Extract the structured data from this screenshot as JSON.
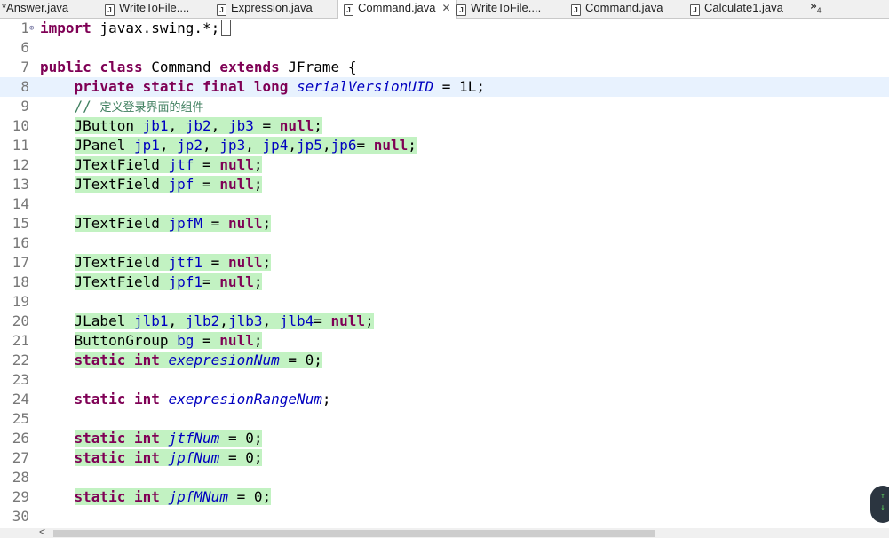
{
  "tabs": [
    {
      "label": "*Answer.java",
      "active": false
    },
    {
      "label": "WriteToFile....",
      "active": false
    },
    {
      "label": "Expression.java",
      "active": false
    },
    {
      "label": "Command.java",
      "active": true
    },
    {
      "label": "WriteToFile....",
      "active": false
    },
    {
      "label": "Command.java",
      "active": false
    },
    {
      "label": "Calculate1.java",
      "active": false
    }
  ],
  "tab_close_glyph": "✕",
  "overflow": {
    "chevron": "»",
    "count": "4"
  },
  "editor": {
    "current_line": 8,
    "highlight_color": "#c2f2c2",
    "lines": [
      {
        "n": "1",
        "tokens": [
          {
            "t": "import",
            "c": "kw"
          },
          {
            "t": " javax.swing.*;",
            "c": ""
          }
        ]
      },
      {
        "n": "6",
        "tokens": []
      },
      {
        "n": "7",
        "tokens": [
          {
            "t": "public",
            "c": "kw"
          },
          {
            "t": " ",
            "c": ""
          },
          {
            "t": "class",
            "c": "kw"
          },
          {
            "t": " Command ",
            "c": ""
          },
          {
            "t": "extends",
            "c": "kw"
          },
          {
            "t": " JFrame {",
            "c": ""
          }
        ]
      },
      {
        "n": "8",
        "tokens": [
          {
            "t": "    ",
            "c": ""
          },
          {
            "t": "private",
            "c": "kw"
          },
          {
            "t": " ",
            "c": ""
          },
          {
            "t": "static",
            "c": "kw"
          },
          {
            "t": " ",
            "c": ""
          },
          {
            "t": "final",
            "c": "kw"
          },
          {
            "t": " ",
            "c": ""
          },
          {
            "t": "long",
            "c": "kw"
          },
          {
            "t": " ",
            "c": ""
          },
          {
            "t": "serialVersionUID",
            "c": "sf"
          },
          {
            "t": " = 1L;",
            "c": ""
          }
        ]
      },
      {
        "n": "9",
        "tokens": [
          {
            "t": "    ",
            "c": ""
          },
          {
            "t": "// ",
            "c": "cm"
          },
          {
            "t": "定义登录界面的组件",
            "c": "cm cmtxt"
          }
        ]
      },
      {
        "n": "10",
        "tokens": [
          {
            "t": "    ",
            "c": ""
          },
          {
            "t": "JButton ",
            "c": "hl"
          },
          {
            "t": "jb1",
            "c": "hl fld"
          },
          {
            "t": ", ",
            "c": "hl"
          },
          {
            "t": "jb2",
            "c": "hl fld"
          },
          {
            "t": ", ",
            "c": "hl"
          },
          {
            "t": "jb3",
            "c": "hl fld"
          },
          {
            "t": " = ",
            "c": "hl"
          },
          {
            "t": "null",
            "c": "hl kw"
          },
          {
            "t": ";",
            "c": "hl"
          }
        ]
      },
      {
        "n": "11",
        "tokens": [
          {
            "t": "    ",
            "c": ""
          },
          {
            "t": "JPanel ",
            "c": "hl"
          },
          {
            "t": "jp1",
            "c": "hl fld"
          },
          {
            "t": ", ",
            "c": "hl"
          },
          {
            "t": "jp2",
            "c": "hl fld"
          },
          {
            "t": ", ",
            "c": "hl"
          },
          {
            "t": "jp3",
            "c": "hl fld"
          },
          {
            "t": ", ",
            "c": "hl"
          },
          {
            "t": "jp4",
            "c": "hl fld"
          },
          {
            "t": ",",
            "c": "hl"
          },
          {
            "t": "jp5",
            "c": "hl fld"
          },
          {
            "t": ",",
            "c": "hl"
          },
          {
            "t": "jp6",
            "c": "hl fld"
          },
          {
            "t": "= ",
            "c": "hl"
          },
          {
            "t": "null",
            "c": "hl kw"
          },
          {
            "t": ";",
            "c": "hl"
          }
        ]
      },
      {
        "n": "12",
        "tokens": [
          {
            "t": "    ",
            "c": ""
          },
          {
            "t": "JTextField ",
            "c": "hl"
          },
          {
            "t": "jtf",
            "c": "hl fld"
          },
          {
            "t": " = ",
            "c": "hl"
          },
          {
            "t": "null",
            "c": "hl kw"
          },
          {
            "t": ";",
            "c": "hl"
          }
        ]
      },
      {
        "n": "13",
        "tokens": [
          {
            "t": "    ",
            "c": ""
          },
          {
            "t": "JTextField ",
            "c": "hl"
          },
          {
            "t": "jpf",
            "c": "hl fld"
          },
          {
            "t": " = ",
            "c": "hl"
          },
          {
            "t": "null",
            "c": "hl kw"
          },
          {
            "t": ";",
            "c": "hl"
          }
        ]
      },
      {
        "n": "14",
        "tokens": []
      },
      {
        "n": "15",
        "tokens": [
          {
            "t": "    ",
            "c": ""
          },
          {
            "t": "JTextField ",
            "c": "hl"
          },
          {
            "t": "jpfM",
            "c": "hl fld"
          },
          {
            "t": " = ",
            "c": "hl"
          },
          {
            "t": "null",
            "c": "hl kw"
          },
          {
            "t": ";",
            "c": "hl"
          }
        ]
      },
      {
        "n": "16",
        "tokens": []
      },
      {
        "n": "17",
        "tokens": [
          {
            "t": "    ",
            "c": ""
          },
          {
            "t": "JTextField ",
            "c": "hl"
          },
          {
            "t": "jtf1",
            "c": "hl fld"
          },
          {
            "t": " = ",
            "c": "hl"
          },
          {
            "t": "null",
            "c": "hl kw"
          },
          {
            "t": ";",
            "c": "hl"
          }
        ]
      },
      {
        "n": "18",
        "tokens": [
          {
            "t": "    ",
            "c": ""
          },
          {
            "t": "JTextField ",
            "c": "hl"
          },
          {
            "t": "jpf1",
            "c": "hl fld"
          },
          {
            "t": "= ",
            "c": "hl"
          },
          {
            "t": "null",
            "c": "hl kw"
          },
          {
            "t": ";",
            "c": "hl"
          }
        ]
      },
      {
        "n": "19",
        "tokens": []
      },
      {
        "n": "20",
        "tokens": [
          {
            "t": "    ",
            "c": ""
          },
          {
            "t": "JLabel ",
            "c": "hl"
          },
          {
            "t": "jlb1",
            "c": "hl fld"
          },
          {
            "t": ", ",
            "c": "hl"
          },
          {
            "t": "jlb2",
            "c": "hl fld"
          },
          {
            "t": ",",
            "c": "hl"
          },
          {
            "t": "jlb3",
            "c": "hl fld"
          },
          {
            "t": ", ",
            "c": "hl"
          },
          {
            "t": "jlb4",
            "c": "hl fld"
          },
          {
            "t": "= ",
            "c": "hl"
          },
          {
            "t": "null",
            "c": "hl kw"
          },
          {
            "t": ";",
            "c": "hl"
          }
        ]
      },
      {
        "n": "21",
        "tokens": [
          {
            "t": "    ",
            "c": ""
          },
          {
            "t": "ButtonGroup ",
            "c": "hl"
          },
          {
            "t": "bg",
            "c": "hl fld"
          },
          {
            "t": " = ",
            "c": "hl"
          },
          {
            "t": "null",
            "c": "hl kw"
          },
          {
            "t": ";",
            "c": "hl"
          }
        ]
      },
      {
        "n": "22",
        "tokens": [
          {
            "t": "    ",
            "c": ""
          },
          {
            "t": "static",
            "c": "hl kw"
          },
          {
            "t": " ",
            "c": "hl"
          },
          {
            "t": "int",
            "c": "hl kw"
          },
          {
            "t": " ",
            "c": "hl"
          },
          {
            "t": "exepresionNum",
            "c": "hl sf"
          },
          {
            "t": " = 0;",
            "c": "hl"
          }
        ]
      },
      {
        "n": "23",
        "tokens": []
      },
      {
        "n": "24",
        "tokens": [
          {
            "t": "    ",
            "c": ""
          },
          {
            "t": "static",
            "c": "kw"
          },
          {
            "t": " ",
            "c": ""
          },
          {
            "t": "int",
            "c": "kw"
          },
          {
            "t": " ",
            "c": ""
          },
          {
            "t": "exepresionRangeNum",
            "c": "sf"
          },
          {
            "t": ";",
            "c": ""
          }
        ]
      },
      {
        "n": "25",
        "tokens": []
      },
      {
        "n": "26",
        "tokens": [
          {
            "t": "    ",
            "c": ""
          },
          {
            "t": "static",
            "c": "hl kw"
          },
          {
            "t": " ",
            "c": "hl"
          },
          {
            "t": "int",
            "c": "hl kw"
          },
          {
            "t": " ",
            "c": "hl"
          },
          {
            "t": "jtfNum",
            "c": "hl sf"
          },
          {
            "t": " = 0;",
            "c": "hl"
          }
        ]
      },
      {
        "n": "27",
        "tokens": [
          {
            "t": "    ",
            "c": ""
          },
          {
            "t": "static",
            "c": "hl kw"
          },
          {
            "t": " ",
            "c": "hl"
          },
          {
            "t": "int",
            "c": "hl kw"
          },
          {
            "t": " ",
            "c": "hl"
          },
          {
            "t": "jpfNum",
            "c": "hl sf"
          },
          {
            "t": " = 0;",
            "c": "hl"
          }
        ]
      },
      {
        "n": "28",
        "tokens": []
      },
      {
        "n": "29",
        "tokens": [
          {
            "t": "    ",
            "c": ""
          },
          {
            "t": "static",
            "c": "hl kw"
          },
          {
            "t": " ",
            "c": "hl"
          },
          {
            "t": "int",
            "c": "hl kw"
          },
          {
            "t": " ",
            "c": "hl"
          },
          {
            "t": "jpfMNum",
            "c": "hl sf"
          },
          {
            "t": " = 0;",
            "c": "hl"
          }
        ]
      },
      {
        "n": "30",
        "tokens": []
      }
    ]
  },
  "scroll_nav": {
    "up": "↑",
    "down": "↓"
  },
  "hscroll_left": "<"
}
